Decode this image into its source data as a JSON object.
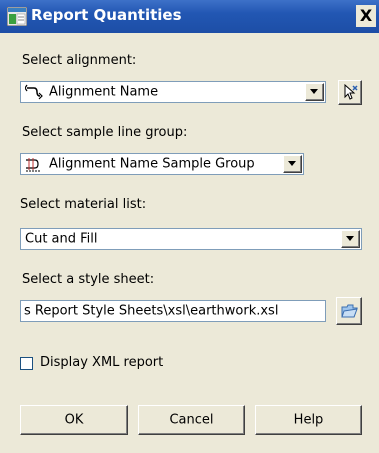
{
  "window": {
    "title": "Report Quantities",
    "close_label": "X"
  },
  "alignment": {
    "label": "Select alignment:",
    "value": "Alignment Name",
    "icon": "alignment-icon",
    "pick_icon": "pick-from-drawing-icon"
  },
  "sample_line_group": {
    "label": "Select sample line group:",
    "value": "Alignment Name Sample Group",
    "icon": "sample-line-group-icon"
  },
  "material_list": {
    "label": "Select material list:",
    "value": "Cut and Fill"
  },
  "style_sheet": {
    "label": "Select a style sheet:",
    "value": "s Report Style Sheets\\xsl\\earthwork.xsl",
    "browse_icon": "open-folder-icon"
  },
  "display_xml": {
    "label": "Display XML report",
    "checked": false
  },
  "buttons": {
    "ok": "OK",
    "cancel": "Cancel",
    "help": "Help"
  },
  "colors": {
    "titlebar": "#2257b3",
    "dialog_bg": "#ece9d8",
    "field_border": "#7f9db9"
  }
}
